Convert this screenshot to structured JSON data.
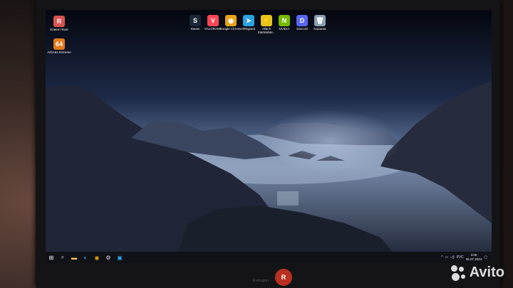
{
  "desktop": {
    "left_icons": [
      {
        "label": "Клиент Rust",
        "icon": "rust-client-icon",
        "color": "#d9534f",
        "glyph": "R"
      },
      {
        "label": "AIDA64 Extreme",
        "icon": "aida64-icon",
        "color": "#e47a1a",
        "glyph": "64"
      }
    ],
    "top_icons": [
      {
        "label": "Steam",
        "icon": "steam-icon",
        "color": "#1b2838",
        "glyph": "S"
      },
      {
        "label": "VALORANT",
        "icon": "valorant-icon",
        "color": "#ff4655",
        "glyph": "V"
      },
      {
        "label": "Google Chrome",
        "icon": "chrome-icon",
        "color": "#e8a317",
        "glyph": "◉"
      },
      {
        "label": "Telegram",
        "icon": "telegram-icon",
        "color": "#2aa3e0",
        "glyph": "➤"
      },
      {
        "label": "Allach StarkWMe...",
        "icon": "allach-icon",
        "color": "#e8c31a",
        "glyph": "⚡"
      },
      {
        "label": "NVIDIA",
        "icon": "nvidia-icon",
        "color": "#76b900",
        "glyph": "N"
      },
      {
        "label": "Discord",
        "icon": "discord-icon",
        "color": "#5865f2",
        "glyph": "D"
      },
      {
        "label": "Корзина",
        "icon": "recycle-bin-icon",
        "color": "#8aa0b0",
        "glyph": "🗑"
      }
    ]
  },
  "taskbar": {
    "buttons": [
      {
        "name": "start-button",
        "icon": "windows-icon",
        "glyph": "⊞",
        "color": "#ffffff"
      },
      {
        "name": "search-button",
        "icon": "search-icon",
        "glyph": "⌕",
        "color": "#dddddd"
      },
      {
        "name": "taskbar-explorer",
        "icon": "folder-icon",
        "glyph": "▬",
        "color": "#f2c94c"
      },
      {
        "name": "taskbar-edge",
        "icon": "edge-icon",
        "glyph": "◐",
        "color": "#2fa6e0"
      },
      {
        "name": "taskbar-chrome",
        "icon": "chrome-icon",
        "glyph": "◉",
        "color": "#e8a317"
      },
      {
        "name": "taskbar-settings",
        "icon": "gear-icon",
        "glyph": "⚙",
        "color": "#dddddd"
      },
      {
        "name": "taskbar-store",
        "icon": "store-icon",
        "glyph": "▣",
        "color": "#2fa6e0"
      }
    ],
    "tray": {
      "language": "РУС",
      "time": "3:06",
      "date": "06.07.2024"
    }
  },
  "monitor": {
    "brand": "Redragon",
    "logo_glyph": "R"
  },
  "watermark": {
    "text": "Avito"
  }
}
